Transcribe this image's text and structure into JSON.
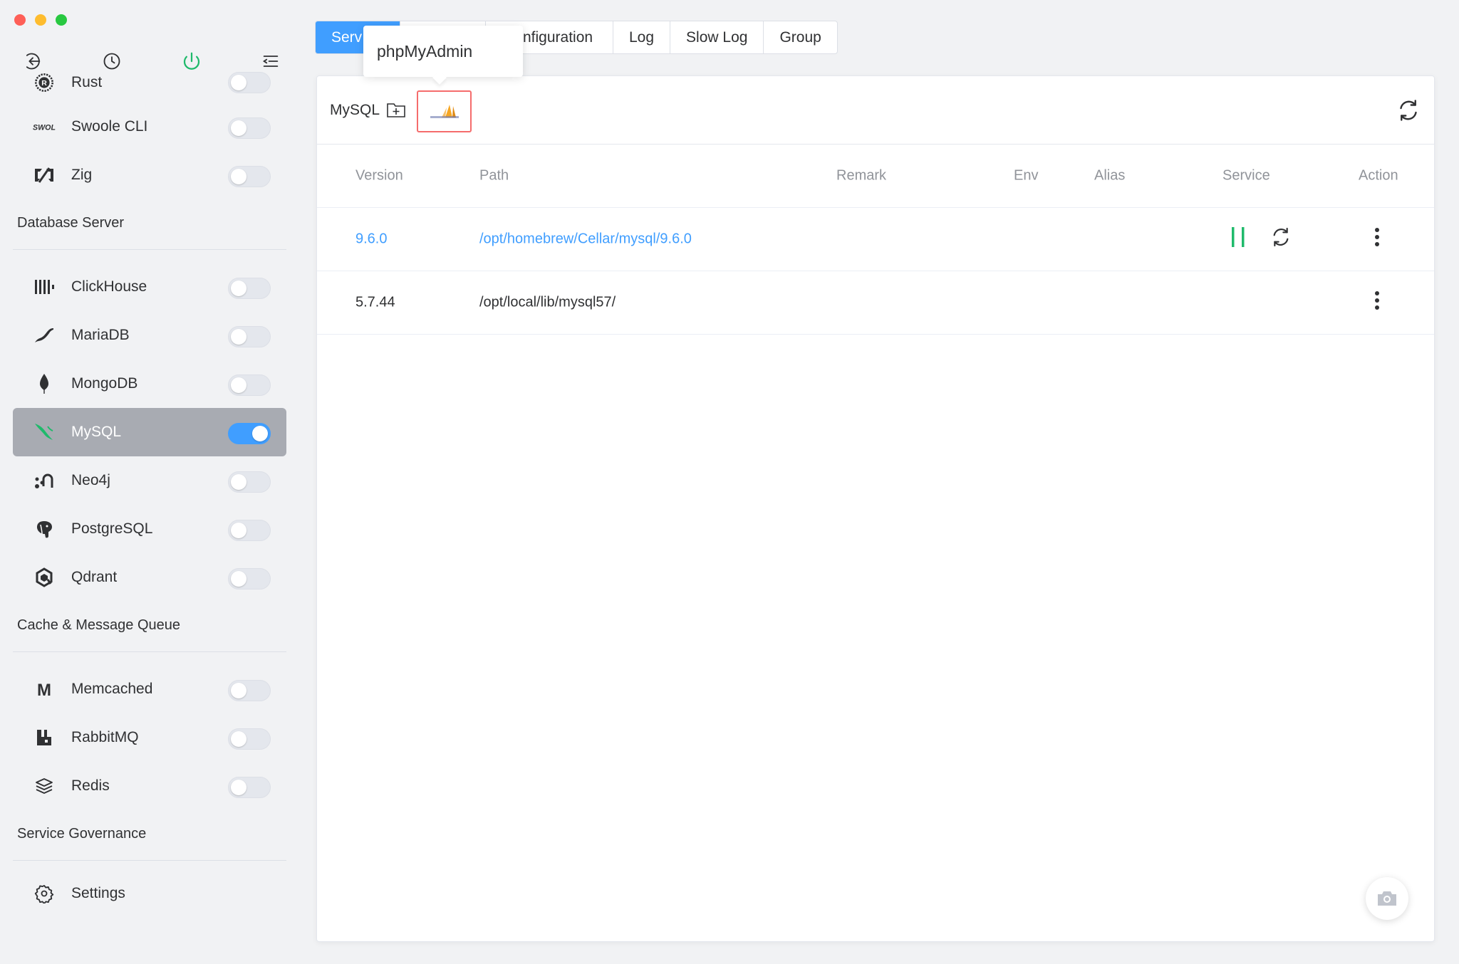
{
  "sidebar": {
    "items_top": [
      {
        "label": "Rust",
        "icon": "rust-icon",
        "enabled": false
      },
      {
        "label": "Swoole CLI",
        "icon": "swoole-icon",
        "enabled": false
      },
      {
        "label": "Zig",
        "icon": "zig-icon",
        "enabled": false
      }
    ],
    "section_database": "Database Server",
    "items_database": [
      {
        "label": "ClickHouse",
        "icon": "clickhouse-icon",
        "enabled": false
      },
      {
        "label": "MariaDB",
        "icon": "mariadb-icon",
        "enabled": false
      },
      {
        "label": "MongoDB",
        "icon": "mongodb-icon",
        "enabled": false
      },
      {
        "label": "MySQL",
        "icon": "mysql-icon",
        "enabled": true
      },
      {
        "label": "Neo4j",
        "icon": "neo4j-icon",
        "enabled": false
      },
      {
        "label": "PostgreSQL",
        "icon": "postgresql-icon",
        "enabled": false
      },
      {
        "label": "Qdrant",
        "icon": "qdrant-icon",
        "enabled": false
      }
    ],
    "section_cache": "Cache & Message Queue",
    "items_cache": [
      {
        "label": "Memcached",
        "icon": "memcached-icon",
        "enabled": false
      },
      {
        "label": "RabbitMQ",
        "icon": "rabbitmq-icon",
        "enabled": false
      },
      {
        "label": "Redis",
        "icon": "redis-icon",
        "enabled": false
      }
    ],
    "section_governance": "Service Governance",
    "items_governance": [
      {
        "label": "Settings",
        "icon": "gear-icon"
      }
    ]
  },
  "tabs": [
    "Serv",
    "",
    "nfiguration",
    "Log",
    "Slow Log",
    "Group"
  ],
  "tooltip": "phpMyAdmin",
  "panel": {
    "title": "MySQL",
    "columns": [
      "Version",
      "Path",
      "Remark",
      "Env",
      "Alias",
      "Service",
      "Action"
    ],
    "rows": [
      {
        "version": "9.6.0",
        "path": "/opt/homebrew/Cellar/mysql/9.6.0",
        "running": true
      },
      {
        "version": "5.7.44",
        "path": "/opt/local/lib/mysql57/",
        "running": false
      }
    ]
  },
  "colors": {
    "accent": "#409eff",
    "running": "#1fba6b",
    "active_bg": "#a8abb2"
  }
}
